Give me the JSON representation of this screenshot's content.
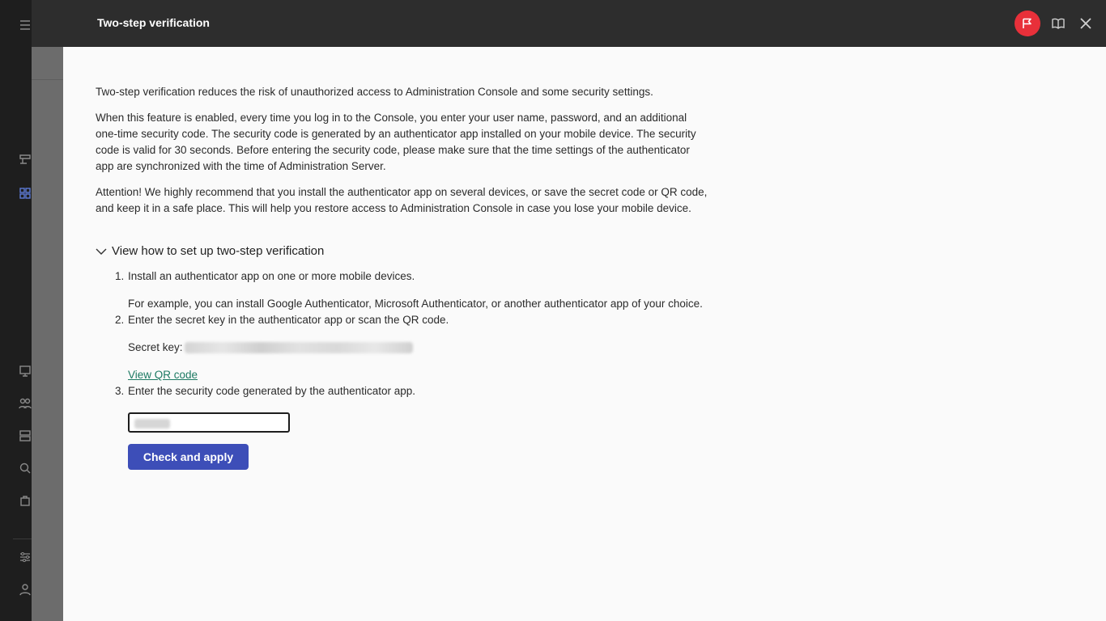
{
  "drawer": {
    "title": "Two-step verification",
    "header_icons": [
      "flag-icon",
      "book-icon",
      "close-icon"
    ],
    "accent_color": "#e8303a"
  },
  "content": {
    "intro": "Two-step verification reduces the risk of unauthorized access to Administration Console and some security settings.",
    "description": "When this feature is enabled, every time you log in to the Console, you enter your user name, password, and an additional one-time security code. The security code is generated by an authenticator app installed on your mobile device. The security code is valid for 30 seconds. Before entering the security code, please make sure that the time settings of the authenticator app are synchronized with the time of Administration Server.",
    "attention": "Attention! We highly recommend that you install the authenticator app on several devices, or save the secret code or QR code, and keep it in a safe place. This will help you restore access to Administration Console in case you lose your mobile device.",
    "expander_label": "View how to set up two-step verification",
    "steps": [
      {
        "num": "1.",
        "text": "Install an authenticator app on one or more mobile devices.",
        "note": "For example, you can install Google Authenticator, Microsoft Authenticator, or another authenticator app of your choice."
      },
      {
        "num": "2.",
        "text": "Enter the secret key in the authenticator app or scan the QR code."
      },
      {
        "num": "3.",
        "text": "Enter the security code generated by the authenticator app."
      }
    ],
    "secret_key_label": "Secret key:",
    "view_qr_link": "View QR code",
    "apply_button": "Check and apply",
    "button_color": "#3d4eb8",
    "link_color": "#1d7a63"
  }
}
